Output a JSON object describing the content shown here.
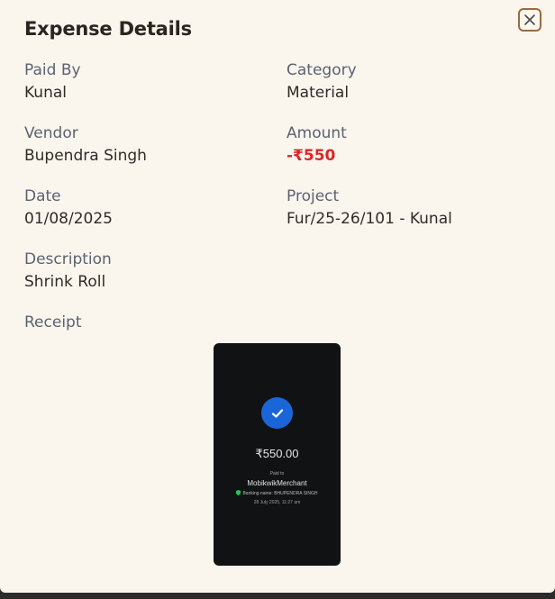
{
  "modal": {
    "title": "Expense Details"
  },
  "fields": {
    "paid_by": {
      "label": "Paid By",
      "value": "Kunal"
    },
    "category": {
      "label": "Category",
      "value": "Material"
    },
    "vendor": {
      "label": "Vendor",
      "value": "Bupendra Singh"
    },
    "amount": {
      "label": "Amount",
      "value": "-₹550"
    },
    "date": {
      "label": "Date",
      "value": "01/08/2025"
    },
    "project": {
      "label": "Project",
      "value": "Fur/25-26/101 - Kunal"
    },
    "description": {
      "label": "Description",
      "value": "Shrink Roll"
    },
    "receipt": {
      "label": "Receipt"
    }
  },
  "receipt_image": {
    "amount": "₹550.00",
    "paid_to_label": "Paid to",
    "merchant": "MobikwikMerchant",
    "banking_name": "Banking name: BHUPENDRA SINGH",
    "datetime": "28 July 2025, 11:27 am"
  },
  "icons": {
    "close": "close-icon",
    "check": "check-icon",
    "shield": "shield-icon"
  },
  "colors": {
    "background": "#faf6ee",
    "amount_negative": "#dc2626",
    "close_border": "#9a6a3e",
    "receipt_bg": "#111214",
    "check_blue": "#1a66d9",
    "shield_green": "#22c55e"
  }
}
